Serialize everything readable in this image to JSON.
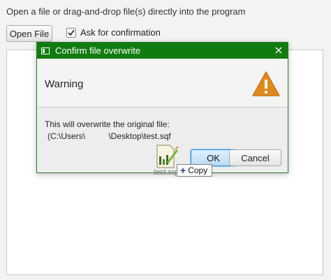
{
  "main": {
    "instructions": "Open a file or drag-and-drop file(s) directly into the program",
    "open_file_label": "Open File",
    "ask_confirmation_label": "Ask for confirmation",
    "ask_confirmation_checked": true
  },
  "dialog": {
    "title": "Confirm file overwrite",
    "header": "Warning",
    "content_line1": "This will overwrite the original file:",
    "content_path_part1": "(C:\\Users\\",
    "content_path_part2": "\\Desktop\\test.sqf",
    "ok_label": "OK",
    "cancel_label": "Cancel",
    "icons": {
      "title_bar": "app-window-icon",
      "close": "close-icon",
      "header": "warning-icon"
    }
  },
  "drag": {
    "file_label": "test.sqf",
    "copy_label": "Copy",
    "icons": {
      "file": "sqf-file-icon",
      "action": "plus-icon"
    }
  },
  "colors": {
    "title_bar": "#107c10",
    "warning": "#e08a1e",
    "ok_button": "#b8dcf7"
  }
}
